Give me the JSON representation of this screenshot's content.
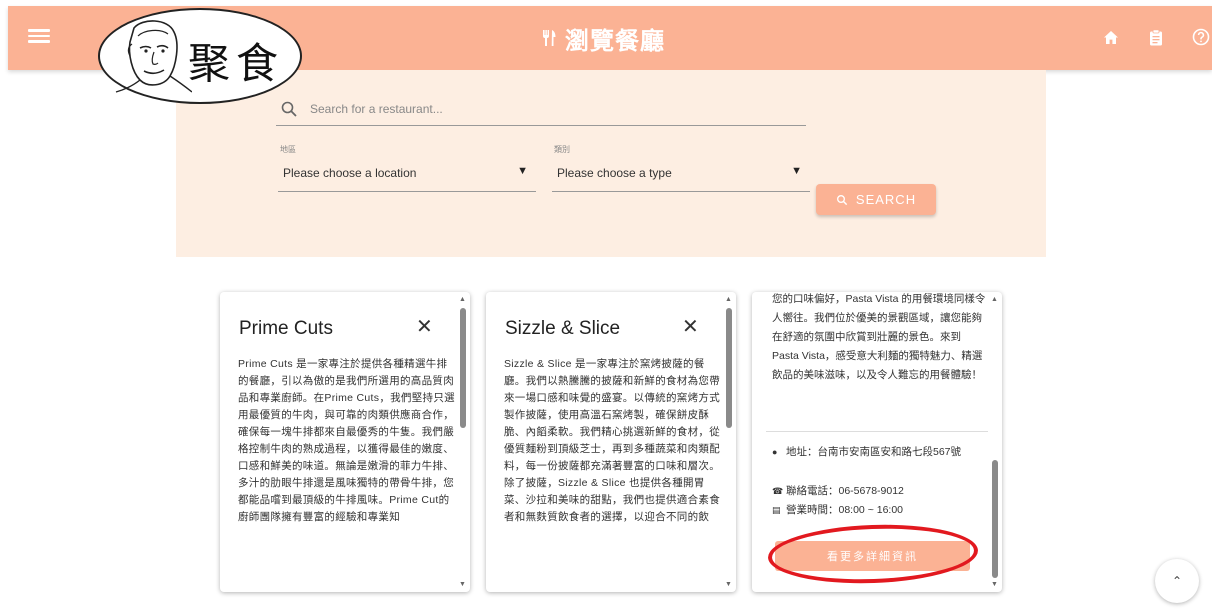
{
  "header": {
    "title": "瀏覽餐廳",
    "title_icon": "fork-knife-icon",
    "right_icons": [
      "home-icon",
      "clipboard-icon",
      "help-icon"
    ],
    "background_color": "#fbb294"
  },
  "logo": {
    "brand_text": "聚食"
  },
  "search": {
    "placeholder": "Search for a restaurant...",
    "location_label": "地區",
    "location_value": "Please choose a location",
    "type_label": "類別",
    "type_value": "Please choose a type",
    "button_label": "SEARCH"
  },
  "cards": [
    {
      "name": "Prime Cuts",
      "description": "Prime Cuts 是一家專注於提供各種精選牛排的餐廳，引以為傲的是我們所選用的高品質肉品和專業廚師。在Prime Cuts，我們堅持只選用最優質的牛肉，與可靠的肉類供應商合作，確保每一塊牛排都來自最優秀的牛隻。我們嚴格控制牛肉的熟成過程，以獲得最佳的嫩度、口感和鮮美的味道。無論是嫩滑的菲力牛排、多汁的肋眼牛排還是風味獨特的帶骨牛排，您都能品嚐到最頂級的牛排風味。Prime Cut的廚師團隊擁有豐富的經驗和專業知"
    },
    {
      "name": "Sizzle & Slice",
      "description": "Sizzle & Slice 是一家專注於窯烤披薩的餐廳。我們以熱騰騰的披薩和新鮮的食材為您帶來一場口感和味覺的盛宴。以傳統的窯烤方式製作披薩，使用高溫石窯烤製，確保餅皮酥脆、內饀柔軟。我們精心挑選新鮮的食材，從優質麵粉到頂級芝士，再到多種蔬菜和肉類配料，每一份披薩都充滿著豐富的口味和層次。除了披薩，Sizzle & Slice 也提供各種開胃菜、沙拉和美味的甜點，我們也提供適合素食者和無麩質飲食者的選擇，以迎合不同的飲"
    },
    {
      "description": "您的口味偏好，Pasta Vista 的用餐環境同樣令人嚮往。我們位於優美的景觀區域，讓您能夠在舒適的氛圍中欣賞到壯麗的景色。來到 Pasta Vista，感受意大利麵的獨特魅力、精選飲品的美味滋味，以及令人難忘的用餐體驗！",
      "address": "地址：台南市安南區安和路七段567號",
      "phone": "聯絡電話：06-5678-9012",
      "hours": "營業時間：08:00 ~ 16:00",
      "more_button": "看更多詳細資訊"
    }
  ]
}
